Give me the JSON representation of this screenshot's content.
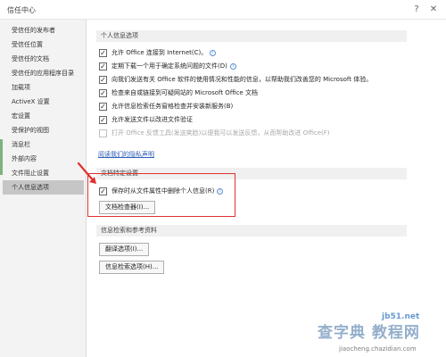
{
  "window": {
    "title": "信任中心",
    "help_glyph": "?",
    "close_glyph": "✕"
  },
  "sidebar": {
    "items": [
      {
        "label": "受信任的发布者"
      },
      {
        "label": "受信任位置"
      },
      {
        "label": "受信任的文档"
      },
      {
        "label": "受信任的应用程序目录"
      },
      {
        "label": "加载项"
      },
      {
        "label": "ActiveX 设置"
      },
      {
        "label": "宏设置"
      },
      {
        "label": "受保护的视图"
      },
      {
        "label": "消息栏"
      },
      {
        "label": "外部内容"
      },
      {
        "label": "文件阻止设置"
      },
      {
        "label": "个人信息选项"
      }
    ],
    "selected": "个人信息选项"
  },
  "personal_info": {
    "header": "个人信息选项",
    "options": [
      {
        "label": "允许 Office 连接到 Internet(C)。",
        "checked": true,
        "info": true
      },
      {
        "label": "定期下载一个用于确定系统问题的文件(D)",
        "checked": true,
        "info": true
      },
      {
        "label": "向我们发送有关 Office 软件的使用情况和性能的信息，以帮助我们改善您的 Microsoft 体验。",
        "checked": true,
        "info": false
      },
      {
        "label": "检查来自或链接到可疑网站的 Microsoft Office 文档",
        "checked": true,
        "info": false
      },
      {
        "label": "允许信息检索任务窗格检查并安装新服务(B)",
        "checked": true,
        "info": false
      },
      {
        "label": "允许发送文件以改进文件验证",
        "checked": true,
        "info": false
      },
      {
        "label": "打开 Office 反馈工具(发送笑脸)以便我可以发送反馈，从而帮助改进 Office(F)",
        "checked": false,
        "info": false,
        "disabled": true
      }
    ],
    "privacy_link": "阅读我们的隐私声明"
  },
  "doc_specific": {
    "header": "文档特定设置",
    "option": {
      "label": "保存时从文件属性中删除个人信息(R)",
      "checked": true,
      "info": true
    },
    "inspector_button": "文档检查器(I)..."
  },
  "research": {
    "header": "信息检索和参考资料",
    "translate_button": "翻译选项(I)...",
    "research_button": "信息检索选项(H)..."
  },
  "watermark": {
    "site": "jb51.net",
    "main": "查字典 教程网",
    "url": "jiaocheng.chazidian.com"
  },
  "colors": {
    "highlight": "#e03030",
    "link": "#2e5fb8",
    "selected": "#c6c6c6"
  }
}
